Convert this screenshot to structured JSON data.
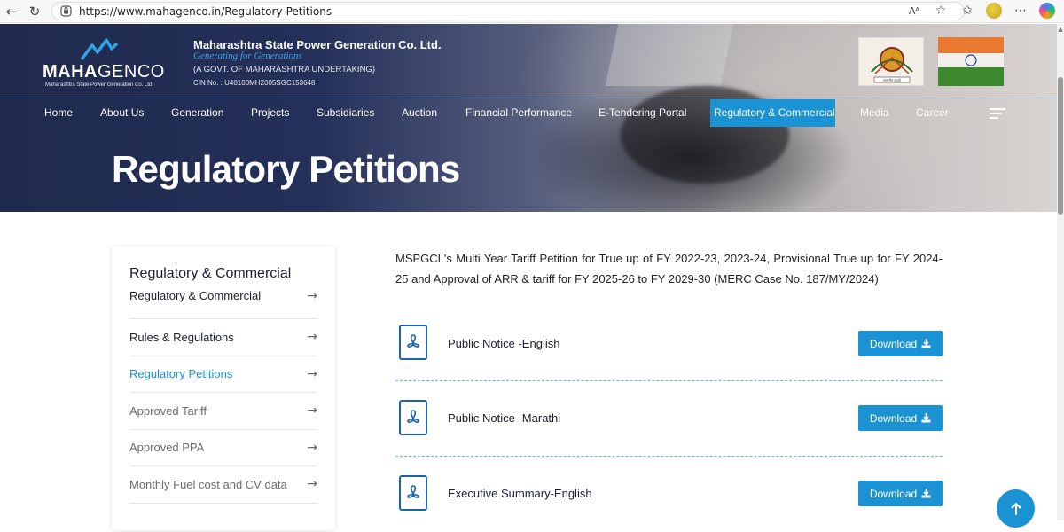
{
  "browser": {
    "url": "https://www.mahagenco.in/Regulatory-Petitions",
    "reader_label": "Aᴬ"
  },
  "header": {
    "logo_word_bold": "MAHA",
    "logo_word_light": "GENCO",
    "logo_sub": "Maharashtra State Power Generation Co. Ltd.",
    "company_name": "Maharashtra State Power Generation Co. Ltd.",
    "tagline": "Generating for Generations",
    "govt": "(A GOVT. OF MAHARASHTRA UNDERTAKING)",
    "cin": "CIN No. : U40100MH2005SGC153648",
    "emblem_caption": "सत्यमेव जयते"
  },
  "nav": {
    "items": [
      {
        "label": "Home"
      },
      {
        "label": "About Us"
      },
      {
        "label": "Generation"
      },
      {
        "label": "Projects"
      },
      {
        "label": "Subsidiaries"
      },
      {
        "label": "Auction"
      },
      {
        "label": "Financial Performance"
      },
      {
        "label": "E-Tendering Portal"
      },
      {
        "label": "Regulatory & Commercial"
      },
      {
        "label": "Media"
      },
      {
        "label": "Career"
      }
    ],
    "active": "Regulatory & Commercial"
  },
  "hero": {
    "title": "Regulatory Petitions"
  },
  "sidebar": {
    "title": "Regulatory & Commercial",
    "items": [
      {
        "label": "Regulatory & Commercial"
      },
      {
        "label": "Rules & Regulations"
      },
      {
        "label": "Regulatory Petitions"
      },
      {
        "label": "Approved Tariff"
      },
      {
        "label": "Approved PPA"
      },
      {
        "label": "Monthly Fuel cost and CV data"
      }
    ],
    "arrow": "→"
  },
  "main": {
    "intro": "MSPGCL's Multi Year Tariff Petition for True up of FY 2022-23, 2023-24, Provisional True up for FY 2024- 25 and Approval of ARR & tariff for FY 2025-26 to FY 2029-30 (MERC Case No. 187/MY/2024)",
    "documents": [
      {
        "label": "Public Notice -English",
        "button": "Download"
      },
      {
        "label": "Public Notice -Marathi",
        "button": "Download"
      },
      {
        "label": "Executive Summary-English",
        "button": "Download"
      }
    ]
  },
  "colors": {
    "accent": "#1b92d3",
    "hero_dark": "#1f2a4d",
    "pdf_icon": "#1d63a8"
  }
}
